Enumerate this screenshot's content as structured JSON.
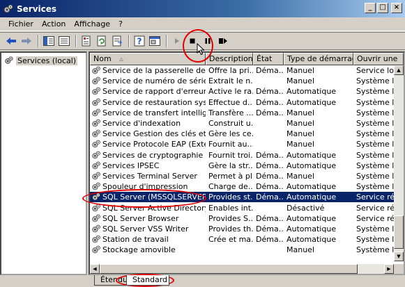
{
  "window": {
    "title": "Services"
  },
  "menu": [
    "Fichier",
    "Action",
    "Affichage",
    "?"
  ],
  "tree": {
    "item": "Services (local)"
  },
  "columns": {
    "nom": "Nom",
    "description": "Description",
    "etat": "État",
    "type": "Type de démarrage",
    "ouvrir": "Ouvrir une"
  },
  "rows": [
    {
      "nom": "Service de la passerelle de la ...",
      "desc": "Offre la pri...",
      "etat": "Déma...",
      "type": "Manuel",
      "ouv": "Service loc"
    },
    {
      "nom": "Service de numéro de série d...",
      "desc": "Extrait le n...",
      "etat": "",
      "type": "Manuel",
      "ouv": "Système lo"
    },
    {
      "nom": "Service de rapport d'erreurs",
      "desc": "Active le ra...",
      "etat": "Déma...",
      "type": "Automatique",
      "ouv": "Système lo"
    },
    {
      "nom": "Service de restauration système",
      "desc": "Effectue d...",
      "etat": "Déma...",
      "type": "Automatique",
      "ouv": "Système lo"
    },
    {
      "nom": "Service de transfert intelligen...",
      "desc": "Transfère ...",
      "etat": "Déma...",
      "type": "Manuel",
      "ouv": "Système lo"
    },
    {
      "nom": "Service d'indexation",
      "desc": "Construit u...",
      "etat": "",
      "type": "Manuel",
      "ouv": "Système lo"
    },
    {
      "nom": "Service Gestion des clés et de...",
      "desc": "Gère les ce...",
      "etat": "",
      "type": "Manuel",
      "ouv": "Système lo"
    },
    {
      "nom": "Service Protocole EAP (Exten...",
      "desc": "Fournit au...",
      "etat": "",
      "type": "Manuel",
      "ouv": "Système lo"
    },
    {
      "nom": "Services de cryptographie",
      "desc": "Fournit troi...",
      "etat": "Déma...",
      "type": "Automatique",
      "ouv": "Système lo"
    },
    {
      "nom": "Services IPSEC",
      "desc": "Gère la str...",
      "etat": "Déma...",
      "type": "Automatique",
      "ouv": "Système lo"
    },
    {
      "nom": "Services Terminal Server",
      "desc": "Permet à pl...",
      "etat": "Déma...",
      "type": "Manuel",
      "ouv": "Système lo"
    },
    {
      "nom": "Spouleur d'impression",
      "desc": "Charge de...",
      "etat": "Déma...",
      "type": "Automatique",
      "ouv": "Système lo"
    },
    {
      "nom": "SQL Server (MSSQLSERVER)",
      "desc": "Provides st...",
      "etat": "Déma...",
      "type": "Automatique",
      "ouv": "Service rés"
    },
    {
      "nom": "SQL Server Active Directory ...",
      "desc": "Enables int...",
      "etat": "",
      "type": "Désactivé",
      "ouv": "Service rés"
    },
    {
      "nom": "SQL Server Browser",
      "desc": "Provides S...",
      "etat": "Déma...",
      "type": "Automatique",
      "ouv": "Service rés"
    },
    {
      "nom": "SQL Server VSS Writer",
      "desc": "Provides th...",
      "etat": "Déma...",
      "type": "Automatique",
      "ouv": "Système lo"
    },
    {
      "nom": "Station de travail",
      "desc": "Crée et ma...",
      "etat": "Déma...",
      "type": "Automatique",
      "ouv": "Système lo"
    },
    {
      "nom": "Stockage amovible",
      "desc": "",
      "etat": "",
      "type": "Manuel",
      "ouv": "Système lo"
    }
  ],
  "tabs": [
    "Étendu",
    "Standard"
  ],
  "colors": {
    "title_start": "#0a246a",
    "selection": "#0a246a",
    "annotation": "#e00000"
  }
}
